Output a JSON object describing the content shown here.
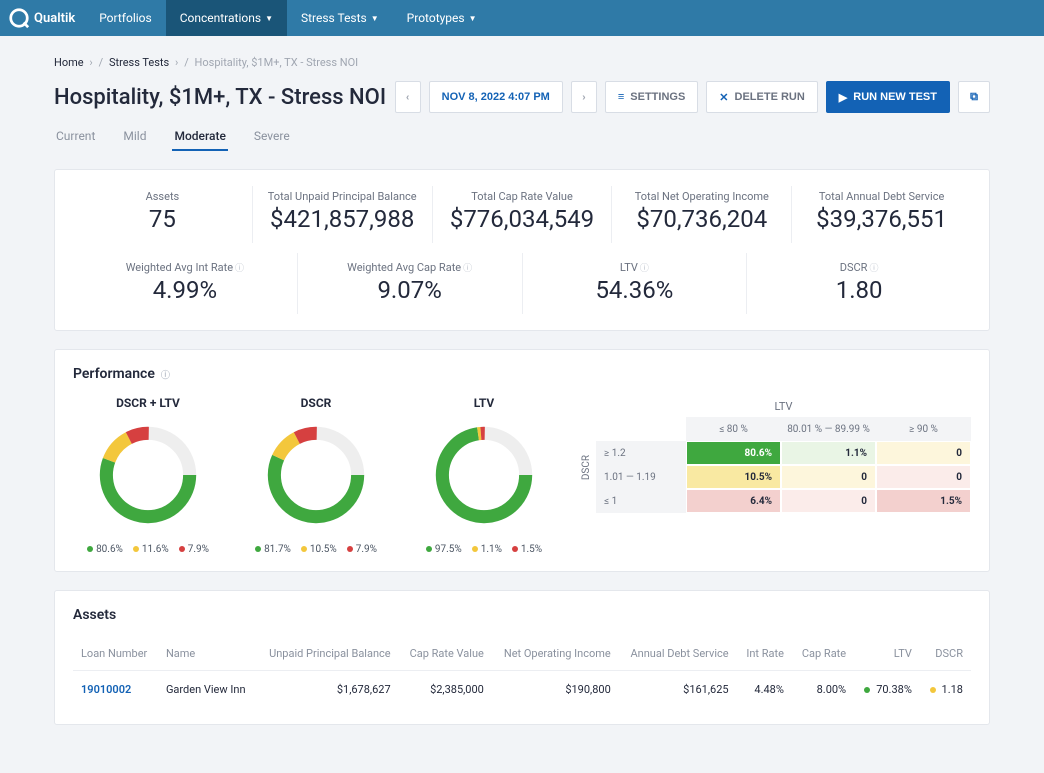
{
  "brand": "Qualtik",
  "nav": {
    "portfolios": "Portfolios",
    "concentrations": "Concentrations",
    "stress_tests": "Stress Tests",
    "prototypes": "Prototypes"
  },
  "breadcrumb": {
    "home": "Home",
    "stress": "Stress Tests",
    "current": "Hospitality, $1M+, TX - Stress NOI"
  },
  "title": "Hospitality, $1M+, TX - Stress NOI",
  "toolbar": {
    "date": "NOV 8, 2022 4:07 PM",
    "settings": "SETTINGS",
    "delete": "DELETE RUN",
    "run": "RUN NEW TEST"
  },
  "tabs": {
    "current": "Current",
    "mild": "Mild",
    "moderate": "Moderate",
    "severe": "Severe"
  },
  "stats": {
    "assets_l": "Assets",
    "assets_v": "75",
    "upb_l": "Total Unpaid Principal Balance",
    "upb_v": "$421,857,988",
    "cap_l": "Total Cap Rate Value",
    "cap_v": "$776,034,549",
    "noi_l": "Total Net Operating Income",
    "noi_v": "$70,736,204",
    "ads_l": "Total Annual Debt Service",
    "ads_v": "$39,376,551",
    "wair_l": "Weighted Avg Int Rate",
    "wair_v": "4.99%",
    "wacr_l": "Weighted Avg Cap Rate",
    "wacr_v": "9.07%",
    "ltv_l": "LTV",
    "ltv_v": "54.36%",
    "dscr_l": "DSCR",
    "dscr_v": "1.80"
  },
  "perf": {
    "title": "Performance",
    "d1_title": "DSCR + LTV",
    "d2_title": "DSCR",
    "d3_title": "LTV",
    "l1a": "80.6%",
    "l1b": "11.6%",
    "l1c": "7.9%",
    "l2a": "81.7%",
    "l2b": "10.5%",
    "l2c": "7.9%",
    "l3a": "97.5%",
    "l3b": "1.1%",
    "l3c": "1.5%"
  },
  "chart_data": [
    {
      "type": "pie",
      "title": "DSCR + LTV",
      "categories": [
        "good",
        "warn",
        "bad"
      ],
      "values": [
        80.6,
        11.6,
        7.9
      ]
    },
    {
      "type": "pie",
      "title": "DSCR",
      "categories": [
        "good",
        "warn",
        "bad"
      ],
      "values": [
        81.7,
        10.5,
        7.9
      ]
    },
    {
      "type": "pie",
      "title": "LTV",
      "categories": [
        "good",
        "warn",
        "bad"
      ],
      "values": [
        97.5,
        1.1,
        1.5
      ]
    }
  ],
  "matrix": {
    "xlabel": "LTV",
    "ylabel": "DSCR",
    "col1": "≤ 80 %",
    "col2": "80.01 % — 89.99 %",
    "col3": "≥ 90 %",
    "row1": "≥ 1.2",
    "row2": "1.01 — 1.19",
    "row3": "≤ 1",
    "c11": "80.6%",
    "c12": "1.1%",
    "c13": "0",
    "c21": "10.5%",
    "c22": "0",
    "c23": "0",
    "c31": "6.4%",
    "c32": "0",
    "c33": "1.5%"
  },
  "assets": {
    "title": "Assets",
    "headers": {
      "loan": "Loan Number",
      "name": "Name",
      "upb": "Unpaid Principal Balance",
      "cap": "Cap Rate Value",
      "noi": "Net Operating Income",
      "ads": "Annual Debt Service",
      "int": "Int Rate",
      "caprate": "Cap Rate",
      "ltv": "LTV",
      "dscr": "DSCR"
    },
    "row1": {
      "loan": "19010002",
      "name": "Garden View Inn",
      "upb": "$1,678,627",
      "cap": "$2,385,000",
      "noi": "$190,800",
      "ads": "$161,625",
      "int": "4.48%",
      "caprate": "8.00%",
      "ltv": "70.38%",
      "dscr": "1.18"
    }
  }
}
